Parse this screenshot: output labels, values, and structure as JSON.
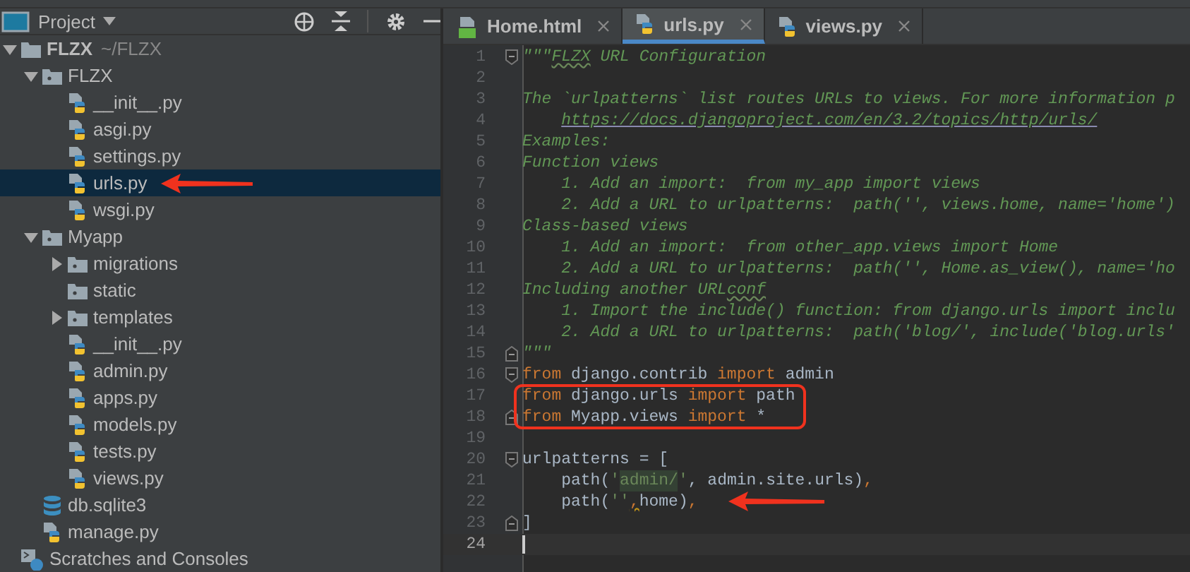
{
  "project_panel": {
    "title": "Project",
    "tree": [
      {
        "label": "FLZX",
        "path": "~/FLZX",
        "kind": "folder",
        "expanded": true,
        "selected": false,
        "children": [
          {
            "label": "FLZX",
            "kind": "module",
            "expanded": true,
            "selected": false,
            "children": [
              {
                "label": "__init__.py",
                "kind": "pyfile",
                "selected": false
              },
              {
                "label": "asgi.py",
                "kind": "pyfile",
                "selected": false
              },
              {
                "label": "settings.py",
                "kind": "pyfile",
                "selected": false
              },
              {
                "label": "urls.py",
                "kind": "pyfile",
                "selected": true,
                "arrow": true
              },
              {
                "label": "wsgi.py",
                "kind": "pyfile",
                "selected": false
              }
            ]
          },
          {
            "label": "Myapp",
            "kind": "module",
            "expanded": true,
            "selected": false,
            "children": [
              {
                "label": "migrations",
                "kind": "module",
                "expanded": false,
                "selected": false
              },
              {
                "label": "static",
                "kind": "module",
                "selected": false
              },
              {
                "label": "templates",
                "kind": "module",
                "expanded": false,
                "selected": false
              },
              {
                "label": "__init__.py",
                "kind": "pyfile",
                "selected": false
              },
              {
                "label": "admin.py",
                "kind": "pyfile",
                "selected": false
              },
              {
                "label": "apps.py",
                "kind": "pyfile",
                "selected": false
              },
              {
                "label": "models.py",
                "kind": "pyfile",
                "selected": false
              },
              {
                "label": "tests.py",
                "kind": "pyfile",
                "selected": false
              },
              {
                "label": "views.py",
                "kind": "pyfile",
                "selected": false
              }
            ]
          },
          {
            "label": "db.sqlite3",
            "kind": "db",
            "selected": false
          },
          {
            "label": "manage.py",
            "kind": "pyfile",
            "selected": false
          }
        ]
      },
      {
        "label": "Scratches and Consoles",
        "kind": "scratch",
        "selected": false
      }
    ]
  },
  "editor": {
    "tabs": [
      {
        "label": "Home.html",
        "kind": "html",
        "selected": false
      },
      {
        "label": "urls.py",
        "kind": "py",
        "selected": true
      },
      {
        "label": "views.py",
        "kind": "py",
        "selected": false
      }
    ],
    "lines": [
      {
        "number": "1",
        "fold_open": true,
        "tokens": [
          {
            "kind": "doc",
            "text": "\"\"\""
          },
          {
            "kind": "doc_typo",
            "text": "FLZX"
          },
          {
            "kind": "doc",
            "text": " URL Configuration"
          }
        ]
      },
      {
        "number": "2"
      },
      {
        "number": "3",
        "tokens": [
          {
            "kind": "doc",
            "text": "The `urlpatterns` list routes URLs to views. For more information p"
          }
        ]
      },
      {
        "number": "4",
        "tokens": [
          {
            "kind": "doc_link",
            "text": "    https://docs.djangoproject.com/en/3.2/topics/http/urls/"
          }
        ]
      },
      {
        "number": "5",
        "tokens": [
          {
            "kind": "doc",
            "text": "Examples:"
          }
        ]
      },
      {
        "number": "6",
        "tokens": [
          {
            "kind": "doc",
            "text": "Function views"
          }
        ]
      },
      {
        "number": "7",
        "tokens": [
          {
            "kind": "doc",
            "text": "    1. Add an import:  from my_app import views"
          }
        ]
      },
      {
        "number": "8",
        "tokens": [
          {
            "kind": "doc",
            "text": "    2. Add a URL to urlpatterns:  path('', views.home, name='home')"
          }
        ]
      },
      {
        "number": "9",
        "tokens": [
          {
            "kind": "doc",
            "text": "Class-based views"
          }
        ]
      },
      {
        "number": "10",
        "tokens": [
          {
            "kind": "doc",
            "text": "    1. Add an import:  from other_app.views import Home"
          }
        ]
      },
      {
        "number": "11",
        "tokens": [
          {
            "kind": "doc",
            "text": "    2. Add a URL to urlpatterns:  path('', Home.as_view(), name='ho"
          }
        ]
      },
      {
        "number": "12",
        "tokens": [
          {
            "kind": "doc",
            "text": "Including another URL"
          },
          {
            "kind": "doc_typo",
            "text": "conf"
          }
        ]
      },
      {
        "number": "13",
        "tokens": [
          {
            "kind": "doc",
            "text": "    1. Import the include() function: from django.urls import inclu"
          }
        ]
      },
      {
        "number": "14",
        "tokens": [
          {
            "kind": "doc",
            "text": "    2. Add a URL to urlpatterns:  path('blog/', include('blog.urls'"
          }
        ]
      },
      {
        "number": "15",
        "fold_close": true,
        "tokens": [
          {
            "kind": "doc",
            "text": "\"\"\""
          }
        ]
      },
      {
        "number": "16",
        "fold_open": true,
        "tokens": [
          {
            "kind": "kw",
            "text": "from"
          },
          {
            "kind": "plain",
            "text": " django.contrib "
          },
          {
            "kind": "kw",
            "text": "import"
          },
          {
            "kind": "plain",
            "text": " admin"
          }
        ]
      },
      {
        "number": "17",
        "boxed": true,
        "tokens": [
          {
            "kind": "kw",
            "text": "from"
          },
          {
            "kind": "plain",
            "text": " django.urls "
          },
          {
            "kind": "kw",
            "text": "import"
          },
          {
            "kind": "plain",
            "text": " path"
          }
        ]
      },
      {
        "number": "18",
        "fold_close": true,
        "boxed": true,
        "tokens": [
          {
            "kind": "kw",
            "text": "from"
          },
          {
            "kind": "plain",
            "text": " Myapp.views "
          },
          {
            "kind": "kw",
            "text": "import"
          },
          {
            "kind": "plain",
            "text": " *"
          }
        ]
      },
      {
        "number": "19"
      },
      {
        "number": "20",
        "fold_open": true,
        "tokens": [
          {
            "kind": "plain",
            "text": "urlpatterns = ["
          }
        ]
      },
      {
        "number": "21",
        "tokens": [
          {
            "kind": "plain",
            "text": "    path("
          },
          {
            "kind": "str",
            "text": "'"
          },
          {
            "kind": "str_hl",
            "text": "admin/"
          },
          {
            "kind": "str",
            "text": "'"
          },
          {
            "kind": "plain",
            "text": ", admin.site.urls)"
          },
          {
            "kind": "punct",
            "text": ","
          }
        ]
      },
      {
        "number": "22",
        "arrow": true,
        "tokens": [
          {
            "kind": "plain",
            "text": "    path("
          },
          {
            "kind": "str",
            "text": "''"
          },
          {
            "kind": "punct_warn",
            "text": ","
          },
          {
            "kind": "plain",
            "text": "home)"
          },
          {
            "kind": "punct",
            "text": ","
          }
        ]
      },
      {
        "number": "23",
        "fold_close": true,
        "tokens": [
          {
            "kind": "plain",
            "text": "]"
          }
        ]
      },
      {
        "number": "24",
        "current": true
      }
    ]
  }
}
